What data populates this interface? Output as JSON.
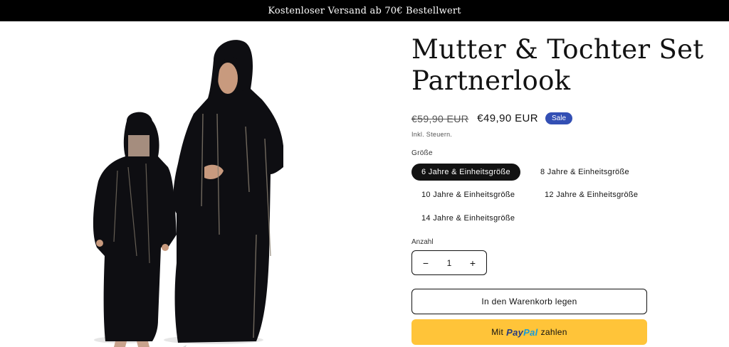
{
  "announcement": "Kostenloser Versand ab 70€ Bestellwert",
  "product": {
    "title_line1": "Mutter & Tochter Set",
    "title_line2": "Partnerlook",
    "price_old": "€59,90 EUR",
    "price_new": "€49,90 EUR",
    "badge": "Sale",
    "tax_note": "Inkl. Steuern."
  },
  "size": {
    "label": "Größe",
    "options": [
      "6 Jahre & Einheitsgröße",
      "8 Jahre & Einheitsgröße",
      "10 Jahre & Einheitsgröße",
      "12 Jahre & Einheitsgröße",
      "14 Jahre & Einheitsgröße"
    ],
    "selected_index": 0
  },
  "quantity": {
    "label": "Anzahl",
    "value": "1",
    "minus": "−",
    "plus": "+"
  },
  "buttons": {
    "add_to_cart": "In den Warenkorb legen",
    "paypal_prefix": "Mit",
    "paypal_pay": "Pay",
    "paypal_pal": "Pal",
    "paypal_suffix": "zahlen"
  },
  "colors": {
    "accent_badge": "#334fb4",
    "paypal_yellow": "#ffc439"
  }
}
